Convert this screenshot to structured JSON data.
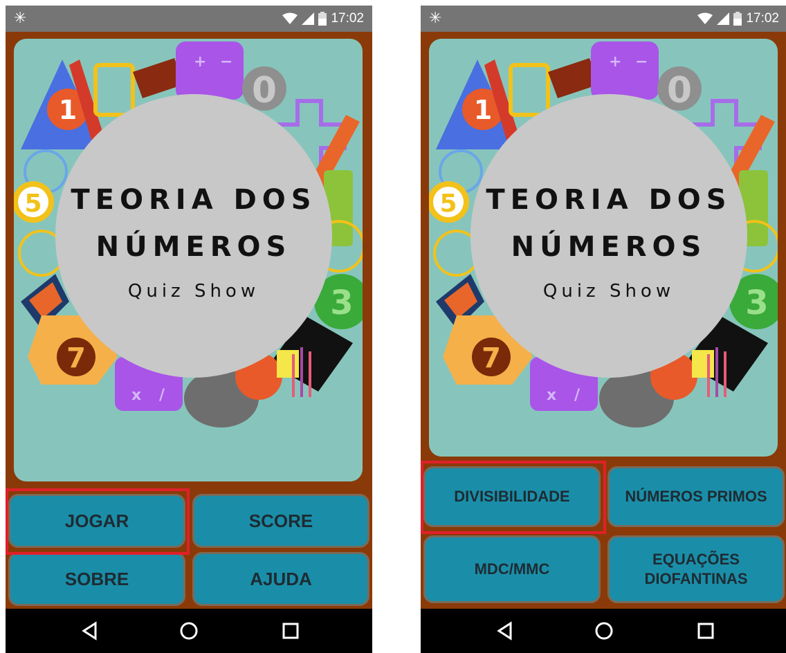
{
  "statusbar": {
    "time": "17:02",
    "left_glyph": "✳",
    "icons": [
      "wifi-icon",
      "signal-icon",
      "battery-icon"
    ]
  },
  "app": {
    "title_line1": "TEORIA DOS",
    "title_line2": "NÚMEROS",
    "subtitle": "Quiz Show",
    "art_labels": {
      "one": "1",
      "five": "5",
      "seven": "7",
      "three": "3",
      "zero": "0",
      "plus": "+",
      "minus": "−",
      "times": "x",
      "divide": "/"
    }
  },
  "screen1": {
    "buttons": [
      {
        "label": "JOGAR"
      },
      {
        "label": "SCORE"
      },
      {
        "label": "SOBRE"
      },
      {
        "label": "AJUDA"
      }
    ],
    "highlighted": "JOGAR"
  },
  "screen2": {
    "buttons": [
      {
        "label": "DIVISIBILIDADE"
      },
      {
        "label": "NÚMEROS PRIMOS"
      },
      {
        "label": "MDC/MMC"
      },
      {
        "label": "EQUAÇÕES\nDIOFANTINAS",
        "line1": "EQUAÇÕES",
        "line2": "DIOFANTINAS"
      }
    ],
    "highlighted": "DIVISIBILIDADE"
  },
  "navbar": {
    "icons": [
      "back-icon",
      "home-icon",
      "recents-icon"
    ]
  },
  "colors": {
    "frame": "#8a3a08",
    "panel": "#87c5bc",
    "button": "#1a8ea8",
    "highlight": "#e0202a",
    "statusbar": "#757575"
  }
}
